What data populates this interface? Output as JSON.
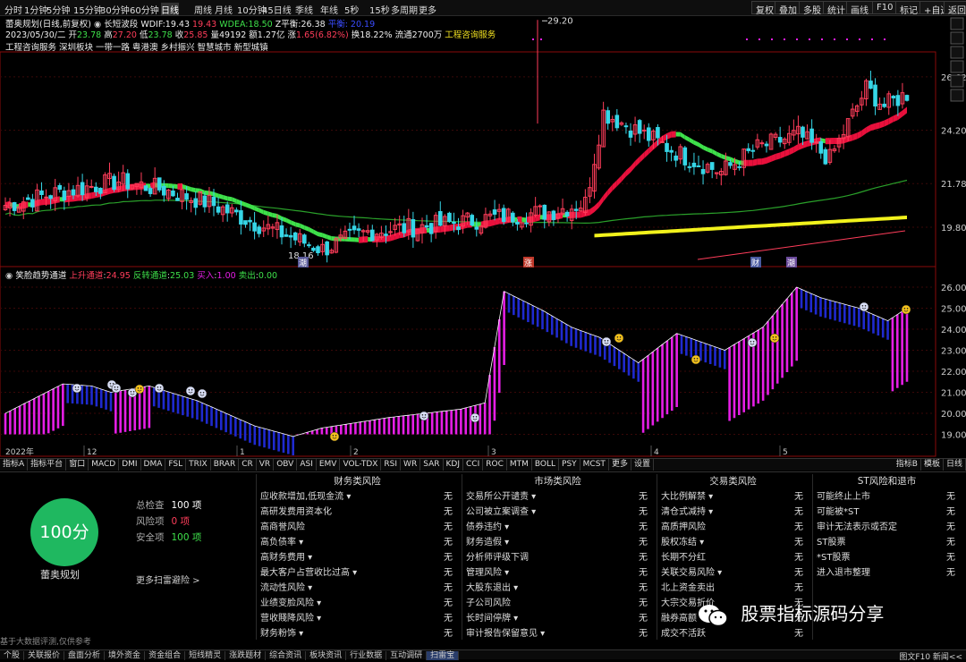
{
  "topbar": {
    "periods": [
      "分时",
      "1分钟",
      "5分钟",
      "15分钟",
      "30分钟",
      "60分钟",
      "日线",
      "周线",
      "月线",
      "10分钟",
      "45日线",
      "季线",
      "年线",
      "5秒",
      "15秒",
      "多周期",
      "更多"
    ],
    "selected": "日线",
    "right_buttons": [
      "复权",
      "叠加",
      "多股",
      "统计",
      "画线",
      "F10",
      "标记",
      "+自选",
      "返回"
    ]
  },
  "header": {
    "stock": "蕾奥规划(日线,前复权)",
    "indicator": "长短波段",
    "wdif_label": "WDIF:",
    "wdif": "19.43",
    "wdea_label": "WDEA:",
    "wdea_a": "19.43",
    "wdea_b": "18.50",
    "zline_label": "Z平衡:",
    "zline": "26.38",
    "extra": "平衡: 20.19",
    "date": "2023/05/30/二",
    "open_label": "开",
    "open": "23.78",
    "high_label": "高",
    "high": "27.20",
    "low_label": "低",
    "low": "23.78",
    "close_label": "收",
    "close": "25.85",
    "vol_label": "量",
    "vol": "49192",
    "amount_label": "额",
    "amount": "1.27亿",
    "chg_label": "涨",
    "chg": "1.65(6.82%)",
    "turnover_label": "换",
    "turnover": "18.22%",
    "float_label": "流通",
    "float": "2700万",
    "tag": "工程咨询服务",
    "concepts": "工程咨询服务  深圳板块  一带一路  粤港澳  乡村振兴  智慧城市  新型城镇"
  },
  "price_axis": [
    "26.62",
    "24.20",
    "21.78",
    "19.80"
  ],
  "indicator": {
    "name": "笑脸趋势通道",
    "up_label": "上升通道",
    "up": "24.95",
    "rev_label": "反转通道",
    "rev": "25.03",
    "buy_label": "买入",
    "buy": "1.00",
    "sell_label": "卖出",
    "sell": "0.00",
    "axis": [
      "26.00",
      "25.00",
      "24.00",
      "23.00",
      "22.00",
      "21.00",
      "20.00",
      "19.00"
    ]
  },
  "chart_labels": {
    "peak": "29.20",
    "low": "18.16",
    "year": "2022年"
  },
  "months": [
    "12",
    "1",
    "2",
    "3",
    "4",
    "5"
  ],
  "markers": [
    "涨",
    "财",
    "预",
    "潮"
  ],
  "indtabs": [
    "指标A",
    "指标平台",
    "窗口",
    "MACD",
    "DMI",
    "DMA",
    "FSL",
    "TRIX",
    "BRAR",
    "CR",
    "VR",
    "OBV",
    "ASI",
    "EMV",
    "VOL-TDX",
    "RSI",
    "WR",
    "SAR",
    "KDJ",
    "CCI",
    "ROC",
    "MTM",
    "BOLL",
    "PSY",
    "MCST",
    "更多",
    "设置"
  ],
  "indtabs_right": [
    "指标B",
    "模板",
    "日线"
  ],
  "risk": {
    "score": "100分",
    "company": "蕾奥规划",
    "total_label": "总检查",
    "total": "100 项",
    "risk_label": "风险项",
    "risk_n": "0 项",
    "safe_label": "安全项",
    "safe": "100 项",
    "more": "更多扫雷避险 >",
    "disclaimer": "基于大数据评测,仅供参考",
    "columns": [
      {
        "title": "财务类风险",
        "rows": [
          "应收款增加,低现金流 ▾",
          "高研发费用资本化",
          "高商誉风险",
          "高负债率 ▾",
          "高财务费用 ▾",
          "最大客户占营收比过高 ▾",
          "流动性风险 ▾",
          "业绩变脸风险 ▾",
          "营收賤降风险 ▾",
          "财务粉饰 ▾"
        ]
      },
      {
        "title": "市场类风险",
        "rows": [
          "交易所公开谴责 ▾",
          "公司被立案调查 ▾",
          "债券违约 ▾",
          "财务造假 ▾",
          "分析师评级下调",
          "管理风险 ▾",
          "大股东退出 ▾",
          "子公司风险",
          "长时间停牌 ▾",
          "审计报告保留意见 ▾"
        ]
      },
      {
        "title": "交易类风险",
        "rows": [
          "大比例解禁 ▾",
          "清仓式减持 ▾",
          "高质押风险",
          "股权冻结 ▾",
          "长期不分红",
          "关联交易风险 ▾",
          "北上资金卖出",
          "大宗交易折价",
          "融券高额",
          "成交不活跃"
        ]
      },
      {
        "title": "ST风险和退市",
        "rows": [
          "可能终止上市",
          "可能被*ST",
          "审计无法表示或否定",
          "ST股票",
          "*ST股票",
          "进入退市整理"
        ]
      }
    ],
    "value": "无"
  },
  "watermark": "股票指标源码分享",
  "status": {
    "items": [
      "个股",
      "关联报价",
      "盘面分析",
      "境外资金",
      "资金组合",
      "短线精灵",
      "涨跌题材",
      "综合资讯",
      "板块资讯",
      "行业数据",
      "互动调研",
      "扫雷宝"
    ],
    "right": "图文F10  新闻<<"
  },
  "colors": {
    "bull": "#ff3d5a",
    "bear": "#36d6e7",
    "ma_red": "#e8103c",
    "ma_green": "#3ee04a",
    "ma_yellow": "#f2f21c",
    "magenta": "#e61ee6",
    "blue": "#1f2ad0",
    "score_green": "#1fb860"
  }
}
